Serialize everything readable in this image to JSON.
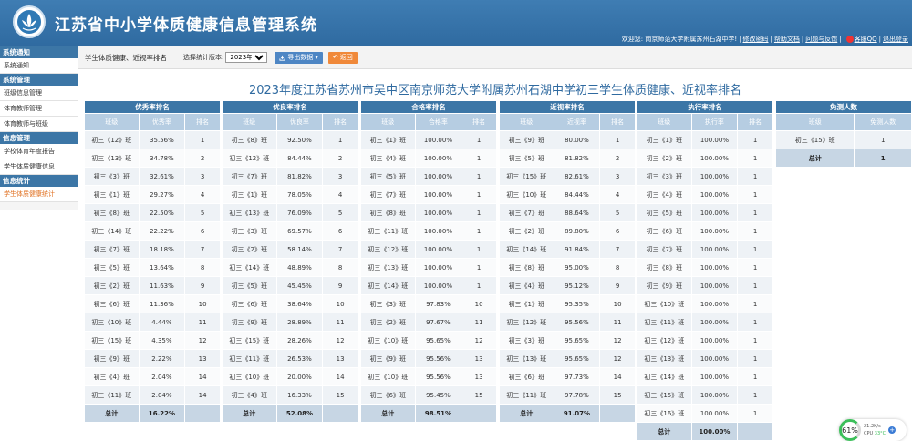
{
  "app": {
    "title": "江苏省中小学体质健康信息管理系统"
  },
  "topnav": {
    "welcome": "欢迎您: 南京师范大学附属苏州石湖中学!",
    "change_password": "修改密码",
    "help_doc": "帮助文档",
    "feedback": "问题与反馈",
    "qq": "客服QQ",
    "logout": "退出登录"
  },
  "sidebar": {
    "groups": [
      {
        "title": "系统通知",
        "items": [
          "系统通知"
        ]
      },
      {
        "title": "系统管理",
        "items": [
          "班级信息管理",
          "体育教师管理",
          "体育教师与班级"
        ]
      },
      {
        "title": "信息管理",
        "items": [
          "学校体育年度报告",
          "学生体质健康信息"
        ]
      },
      {
        "title": "信息统计",
        "items": [
          "学生体质健康统计"
        ]
      }
    ],
    "active_item": "学生体质健康统计"
  },
  "filterbar": {
    "report_name": "学生体质健康、近视率排名",
    "version_label": "选择统计版本:",
    "version_value": "2023年度",
    "export_label": "导出数据",
    "back_label": "返回"
  },
  "main_title": "2023年度江苏省苏州市吴中区南京师范大学附属苏州石湖中学初三学生体质健康、近视率排名",
  "tables": [
    {
      "title": "优秀率排名",
      "cols": [
        "班级",
        "优秀率",
        "排名"
      ],
      "rows": [
        [
          "初三《12》班",
          "35.56%",
          "1"
        ],
        [
          "初三《13》班",
          "34.78%",
          "2"
        ],
        [
          "初三《3》班",
          "32.61%",
          "3"
        ],
        [
          "初三《1》班",
          "29.27%",
          "4"
        ],
        [
          "初三《8》班",
          "22.50%",
          "5"
        ],
        [
          "初三《14》班",
          "22.22%",
          "6"
        ],
        [
          "初三《7》班",
          "18.18%",
          "7"
        ],
        [
          "初三《5》班",
          "13.64%",
          "8"
        ],
        [
          "初三《2》班",
          "11.63%",
          "9"
        ],
        [
          "初三《6》班",
          "11.36%",
          "10"
        ],
        [
          "初三《10》班",
          "4.44%",
          "11"
        ],
        [
          "初三《15》班",
          "4.35%",
          "12"
        ],
        [
          "初三《9》班",
          "2.22%",
          "13"
        ],
        [
          "初三《4》班",
          "2.04%",
          "14"
        ],
        [
          "初三《11》班",
          "2.04%",
          "14"
        ]
      ],
      "total": [
        "总计",
        "16.22%",
        ""
      ]
    },
    {
      "title": "优良率排名",
      "cols": [
        "班级",
        "优良率",
        "排名"
      ],
      "rows": [
        [
          "初三《8》班",
          "92.50%",
          "1"
        ],
        [
          "初三《12》班",
          "84.44%",
          "2"
        ],
        [
          "初三《7》班",
          "81.82%",
          "3"
        ],
        [
          "初三《1》班",
          "78.05%",
          "4"
        ],
        [
          "初三《13》班",
          "76.09%",
          "5"
        ],
        [
          "初三《3》班",
          "69.57%",
          "6"
        ],
        [
          "初三《2》班",
          "58.14%",
          "7"
        ],
        [
          "初三《14》班",
          "48.89%",
          "8"
        ],
        [
          "初三《5》班",
          "45.45%",
          "9"
        ],
        [
          "初三《6》班",
          "38.64%",
          "10"
        ],
        [
          "初三《9》班",
          "28.89%",
          "11"
        ],
        [
          "初三《15》班",
          "28.26%",
          "12"
        ],
        [
          "初三《11》班",
          "26.53%",
          "13"
        ],
        [
          "初三《10》班",
          "20.00%",
          "14"
        ],
        [
          "初三《4》班",
          "16.33%",
          "15"
        ]
      ],
      "total": [
        "总计",
        "52.08%",
        ""
      ]
    },
    {
      "title": "合格率排名",
      "cols": [
        "班级",
        "合格率",
        "排名"
      ],
      "rows": [
        [
          "初三《1》班",
          "100.00%",
          "1"
        ],
        [
          "初三《4》班",
          "100.00%",
          "1"
        ],
        [
          "初三《5》班",
          "100.00%",
          "1"
        ],
        [
          "初三《7》班",
          "100.00%",
          "1"
        ],
        [
          "初三《8》班",
          "100.00%",
          "1"
        ],
        [
          "初三《11》班",
          "100.00%",
          "1"
        ],
        [
          "初三《12》班",
          "100.00%",
          "1"
        ],
        [
          "初三《13》班",
          "100.00%",
          "1"
        ],
        [
          "初三《14》班",
          "100.00%",
          "1"
        ],
        [
          "初三《3》班",
          "97.83%",
          "10"
        ],
        [
          "初三《2》班",
          "97.67%",
          "11"
        ],
        [
          "初三《10》班",
          "95.65%",
          "12"
        ],
        [
          "初三《9》班",
          "95.56%",
          "13"
        ],
        [
          "初三《10》班",
          "95.56%",
          "13"
        ],
        [
          "初三《6》班",
          "95.45%",
          "15"
        ]
      ],
      "total": [
        "总计",
        "98.51%",
        ""
      ]
    },
    {
      "title": "近视率排名",
      "cols": [
        "班级",
        "近视率",
        "排名"
      ],
      "rows": [
        [
          "初三《9》班",
          "80.00%",
          "1"
        ],
        [
          "初三《5》班",
          "81.82%",
          "2"
        ],
        [
          "初三《15》班",
          "82.61%",
          "3"
        ],
        [
          "初三《10》班",
          "84.44%",
          "4"
        ],
        [
          "初三《7》班",
          "88.64%",
          "5"
        ],
        [
          "初三《2》班",
          "89.80%",
          "6"
        ],
        [
          "初三《14》班",
          "91.84%",
          "7"
        ],
        [
          "初三《8》班",
          "95.00%",
          "8"
        ],
        [
          "初三《4》班",
          "95.12%",
          "9"
        ],
        [
          "初三《1》班",
          "95.35%",
          "10"
        ],
        [
          "初三《12》班",
          "95.56%",
          "11"
        ],
        [
          "初三《3》班",
          "95.65%",
          "12"
        ],
        [
          "初三《13》班",
          "95.65%",
          "12"
        ],
        [
          "初三《6》班",
          "97.73%",
          "14"
        ],
        [
          "初三《11》班",
          "97.78%",
          "15"
        ]
      ],
      "total": [
        "总计",
        "91.07%",
        ""
      ]
    },
    {
      "title": "执行率排名",
      "cols": [
        "班级",
        "执行率",
        "排名"
      ],
      "rows": [
        [
          "初三《1》班",
          "100.00%",
          "1"
        ],
        [
          "初三《2》班",
          "100.00%",
          "1"
        ],
        [
          "初三《3》班",
          "100.00%",
          "1"
        ],
        [
          "初三《4》班",
          "100.00%",
          "1"
        ],
        [
          "初三《5》班",
          "100.00%",
          "1"
        ],
        [
          "初三《6》班",
          "100.00%",
          "1"
        ],
        [
          "初三《7》班",
          "100.00%",
          "1"
        ],
        [
          "初三《8》班",
          "100.00%",
          "1"
        ],
        [
          "初三《9》班",
          "100.00%",
          "1"
        ],
        [
          "初三《10》班",
          "100.00%",
          "1"
        ],
        [
          "初三《11》班",
          "100.00%",
          "1"
        ],
        [
          "初三《12》班",
          "100.00%",
          "1"
        ],
        [
          "初三《13》班",
          "100.00%",
          "1"
        ],
        [
          "初三《14》班",
          "100.00%",
          "1"
        ],
        [
          "初三《15》班",
          "100.00%",
          "1"
        ],
        [
          "初三《16》班",
          "100.00%",
          "1"
        ]
      ],
      "total": [
        "总计",
        "100.00%",
        ""
      ]
    },
    {
      "title": "免测人数",
      "cols": [
        "班级",
        "免测人数"
      ],
      "rows": [
        [
          "初三《15》班",
          "1"
        ]
      ],
      "total": [
        "总计",
        "1"
      ]
    }
  ],
  "cpu_widget": {
    "percent": "61%",
    "net": "21.2K/s",
    "cpu_label": "CPU",
    "temp": "33°C"
  }
}
